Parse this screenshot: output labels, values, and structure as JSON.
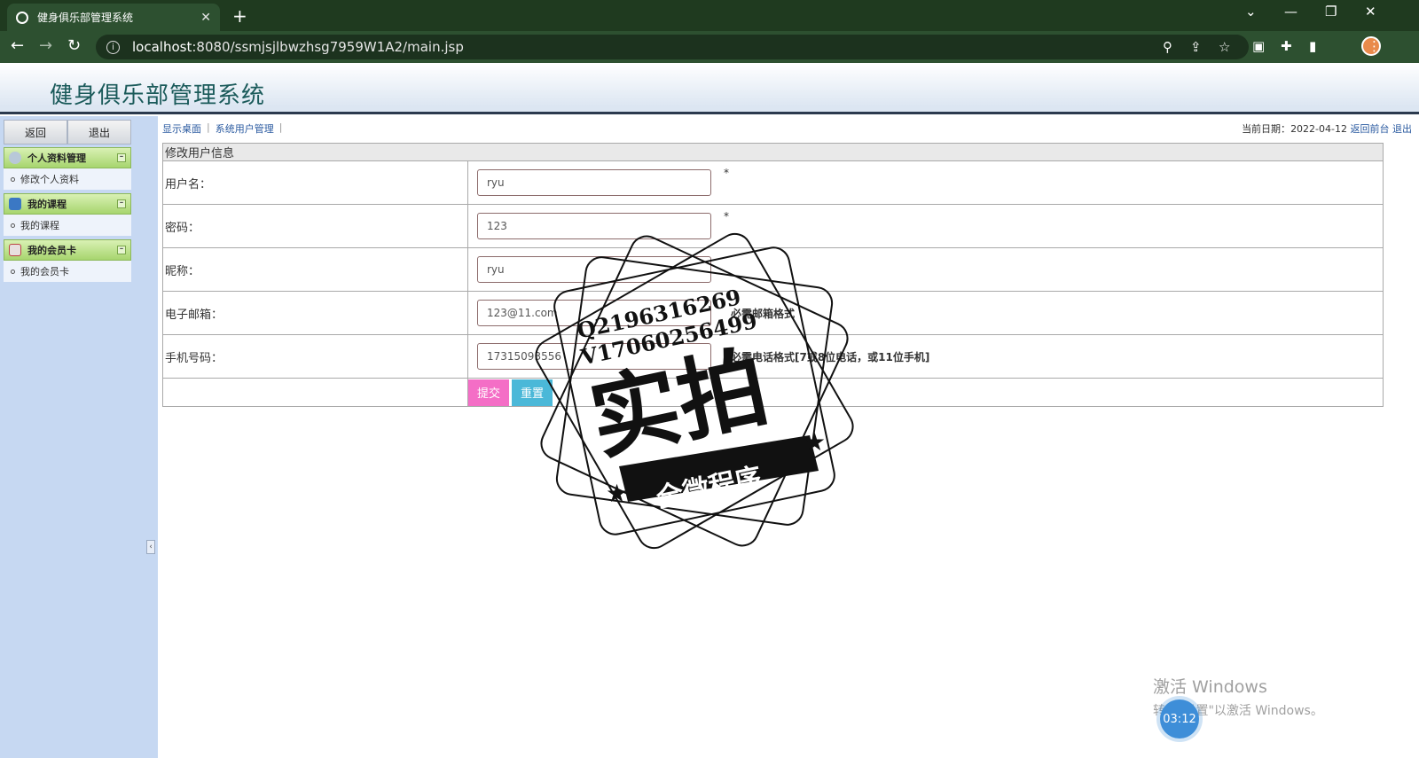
{
  "browser": {
    "tab_title": "健身俱乐部管理系统",
    "tab_close": "✕",
    "new_tab": "+",
    "url_host": "localhost",
    "url_path": ":8080/ssmjsjlbwzhsg7959W1A2/main.jsp"
  },
  "app": {
    "title": "健身俱乐部管理系统"
  },
  "sidebar": {
    "back_label": "返回",
    "logout_label": "退出",
    "groups": [
      {
        "title": "个人资料管理",
        "items": [
          {
            "label": "修改个人资料"
          }
        ]
      },
      {
        "title": "我的课程",
        "items": [
          {
            "label": "我的课程"
          }
        ]
      },
      {
        "title": "我的会员卡",
        "items": [
          {
            "label": "我的会员卡"
          }
        ]
      }
    ]
  },
  "breadcrumb": {
    "items": [
      "显示桌面",
      "系统用户管理"
    ]
  },
  "header_right": {
    "date_label": "当前日期：",
    "date_value": "2022-04-12",
    "front_link": "返回前台",
    "logout_link": "退出"
  },
  "form": {
    "caption": "修改用户信息",
    "fields": [
      {
        "label": "用户名：",
        "value": "ryu",
        "required": "*",
        "hint": ""
      },
      {
        "label": "密码：",
        "value": "123",
        "required": "*",
        "hint": ""
      },
      {
        "label": "昵称：",
        "value": "ryu",
        "required": "",
        "hint": ""
      },
      {
        "label": "电子邮箱：",
        "value": "123@11.com",
        "required": "",
        "hint": "必需邮箱格式"
      },
      {
        "label": "手机号码：",
        "value": "17315093556",
        "required": "",
        "hint": "必需电话格式[7或8位电话，或11位手机]"
      }
    ],
    "submit_label": "提交",
    "reset_label": "重置"
  },
  "stamp": {
    "line1": "Q2196316269",
    "line2": "V17060256499",
    "main": "实拍",
    "banner": "全微程序"
  },
  "windows_watermark": {
    "line1": "激活 Windows",
    "line2": "转到\"设置\"以激活 Windows。"
  },
  "timer": "03:12",
  "colors": {
    "chrome": "#2d5030",
    "sidebar": "#c6d8f2",
    "menu_head": "#a7d56e",
    "submit": "#f46ec6",
    "reset": "#4bb8d8"
  }
}
